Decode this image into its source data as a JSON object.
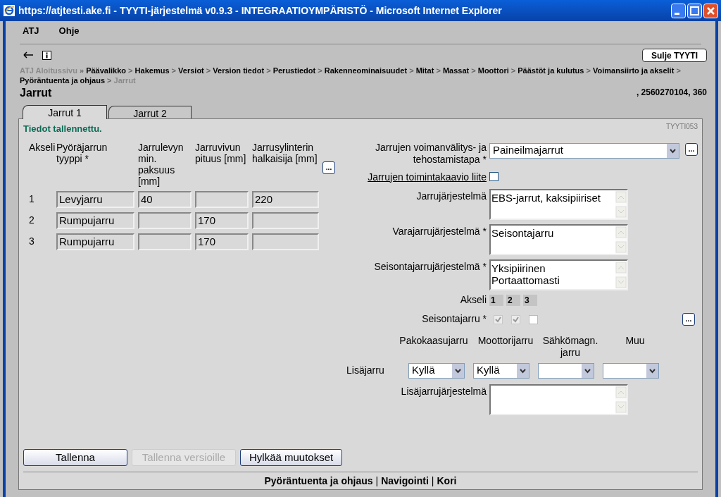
{
  "window": {
    "title": "https://atjtesti.ake.fi - TYYTI-järjestelmä v0.9.3 - INTEGRAATIOYMPÄRISTÖ - Microsoft Internet Explorer"
  },
  "menu": [
    "ATJ",
    "Ohje"
  ],
  "close_button": "Sulje TYYTI",
  "breadcrumb": [
    {
      "label": "ATJ Aloitussivu",
      "kind": "home",
      "sep": "»"
    },
    {
      "label": "Päävalikko",
      "kind": "link",
      "sep": ">"
    },
    {
      "label": "Hakemus",
      "kind": "link",
      "sep": ">"
    },
    {
      "label": "Versiot",
      "kind": "link",
      "sep": ">"
    },
    {
      "label": "Version tiedot",
      "kind": "link",
      "sep": ">"
    },
    {
      "label": "Perustiedot",
      "kind": "link",
      "sep": ">"
    },
    {
      "label": "Rakenneominaisuudet",
      "kind": "link",
      "sep": ">"
    },
    {
      "label": "Mitat",
      "kind": "link",
      "sep": ">"
    },
    {
      "label": "Massat",
      "kind": "link",
      "sep": ">"
    },
    {
      "label": "Moottori",
      "kind": "link",
      "sep": ">"
    },
    {
      "label": "Päästöt ja kulutus",
      "kind": "link",
      "sep": ">"
    },
    {
      "label": "Voimansiirto ja akselit",
      "kind": "link",
      "sep": ">"
    },
    {
      "label": "Pyöräntuenta ja ohjaus",
      "kind": "link",
      "sep": ">"
    },
    {
      "label": "Jarrut",
      "kind": "current"
    }
  ],
  "page_title": "Jarrut",
  "vehicle_info": ", 2560270104, 360",
  "tabs": [
    {
      "label": "Jarrut 1",
      "selected": true
    },
    {
      "label": "Jarrut 2",
      "selected": false
    }
  ],
  "status_message": "Tiedot tallennettu.",
  "screen_code": "TYYTI053",
  "axle_table": {
    "columns": [
      "Akseli",
      "Pyöräjarrun tyyppi *",
      "Jarrulevyn min. paksuus [mm]",
      "Jarruvivun pituus [mm]",
      "Jarrusylinterin halkaisija [mm]"
    ],
    "more_button": "...",
    "rows": [
      [
        "1",
        "Levyjarru",
        "40",
        null,
        "220"
      ],
      [
        "2",
        "Rumpujarru",
        null,
        "170",
        null
      ],
      [
        "3",
        "Rumpujarru",
        null,
        "170",
        null
      ]
    ]
  },
  "transmission": {
    "label": "Jarrujen voimanvälitys- ja tehostamistapa *",
    "value": "Paineilmajarrut",
    "more_button": "..."
  },
  "diagram_attachment": {
    "label": "Jarrujen toimintakaavio liite",
    "checked": false
  },
  "text_fields": [
    {
      "label": "Jarrujärjestelmä",
      "value": "EBS-jarrut, kaksipiiriset"
    },
    {
      "label": "Varajarrujärjestelmä *",
      "value": "Seisontajarru"
    },
    {
      "label": "Seisontajarrujärjestelmä *",
      "value": "Yksipiirinen\nPortaattomasti"
    }
  ],
  "axles": {
    "label": "Akseli",
    "numbers": [
      "1",
      "2",
      "3"
    ]
  },
  "parking_brake": {
    "label": "Seisontajarru *",
    "checkboxes": [
      {
        "checked": true,
        "disabled": true
      },
      {
        "checked": true,
        "disabled": true
      },
      {
        "checked": false,
        "disabled": false
      }
    ],
    "more_button": "..."
  },
  "additional_brake": {
    "label": "Lisäjarru",
    "columns": [
      {
        "header": "Pakokaasujarru",
        "value": "Kyllä"
      },
      {
        "header": "Moottorijarru",
        "value": "Kyllä"
      },
      {
        "header": "Sähkömagn. jarru"
      },
      {
        "header": "Muu"
      }
    ]
  },
  "additional_system": {
    "label": "Lisäjarrujärjestelmä"
  },
  "buttons": [
    {
      "label": "Tallenna",
      "disabled": false
    },
    {
      "label": "Tallenna versioille",
      "disabled": true
    },
    {
      "label": "Hylkää muutokset",
      "disabled": false
    }
  ],
  "footer": [
    {
      "label": "Pyöräntuenta ja ohjaus",
      "kind": "link"
    },
    {
      "label": "|",
      "kind": "separator"
    },
    {
      "label": "Navigointi",
      "kind": "link"
    },
    {
      "label": "|",
      "kind": "separator"
    },
    {
      "label": "Kori",
      "kind": "link"
    }
  ]
}
